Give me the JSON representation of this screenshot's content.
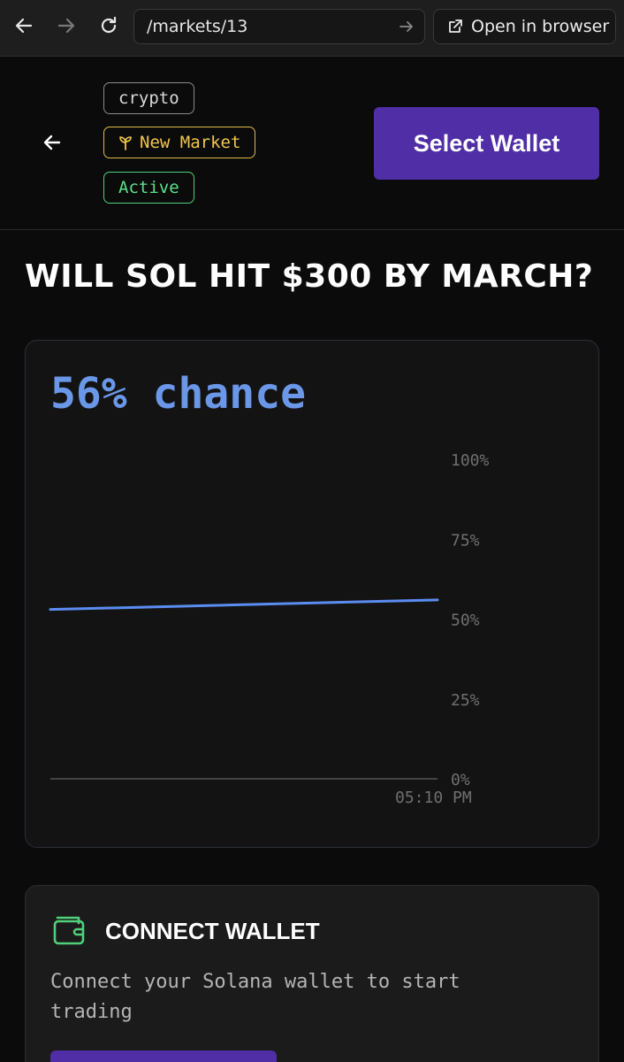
{
  "browser": {
    "url": "/markets/13",
    "open_in_browser": "Open in browser"
  },
  "header": {
    "tags": {
      "category": "crypto",
      "new_market": "New Market",
      "status": "Active"
    },
    "select_wallet": "Select Wallet"
  },
  "market": {
    "title": "WILL SOL HIT $300 BY MARCH?"
  },
  "chart": {
    "chance_text": "56% chance",
    "line_color": "#5b8cf0"
  },
  "chart_data": {
    "type": "line",
    "title": "",
    "xlabel": "",
    "ylabel": "",
    "ylim": [
      0,
      100
    ],
    "y_ticks": [
      "100%",
      "75%",
      "50%",
      "25%",
      "0%"
    ],
    "x_ticks": [
      "05:10 PM"
    ],
    "series": [
      {
        "values": [
          53,
          56
        ]
      }
    ],
    "grid": false
  },
  "connect": {
    "title": "CONNECT WALLET",
    "description": "Connect your Solana wallet to start trading"
  },
  "colors": {
    "accent": "#4f2ea6",
    "chance": "#6b97e8",
    "tag_yellow": "#f0c54d",
    "tag_green": "#5ce08a",
    "wallet_icon": "#4fd07a"
  },
  "icons": {
    "back": "arrow-left-icon",
    "forward": "arrow-right-icon",
    "reload": "reload-icon",
    "external": "external-link-icon",
    "sprout": "sprout-icon",
    "wallet": "wallet-icon"
  }
}
